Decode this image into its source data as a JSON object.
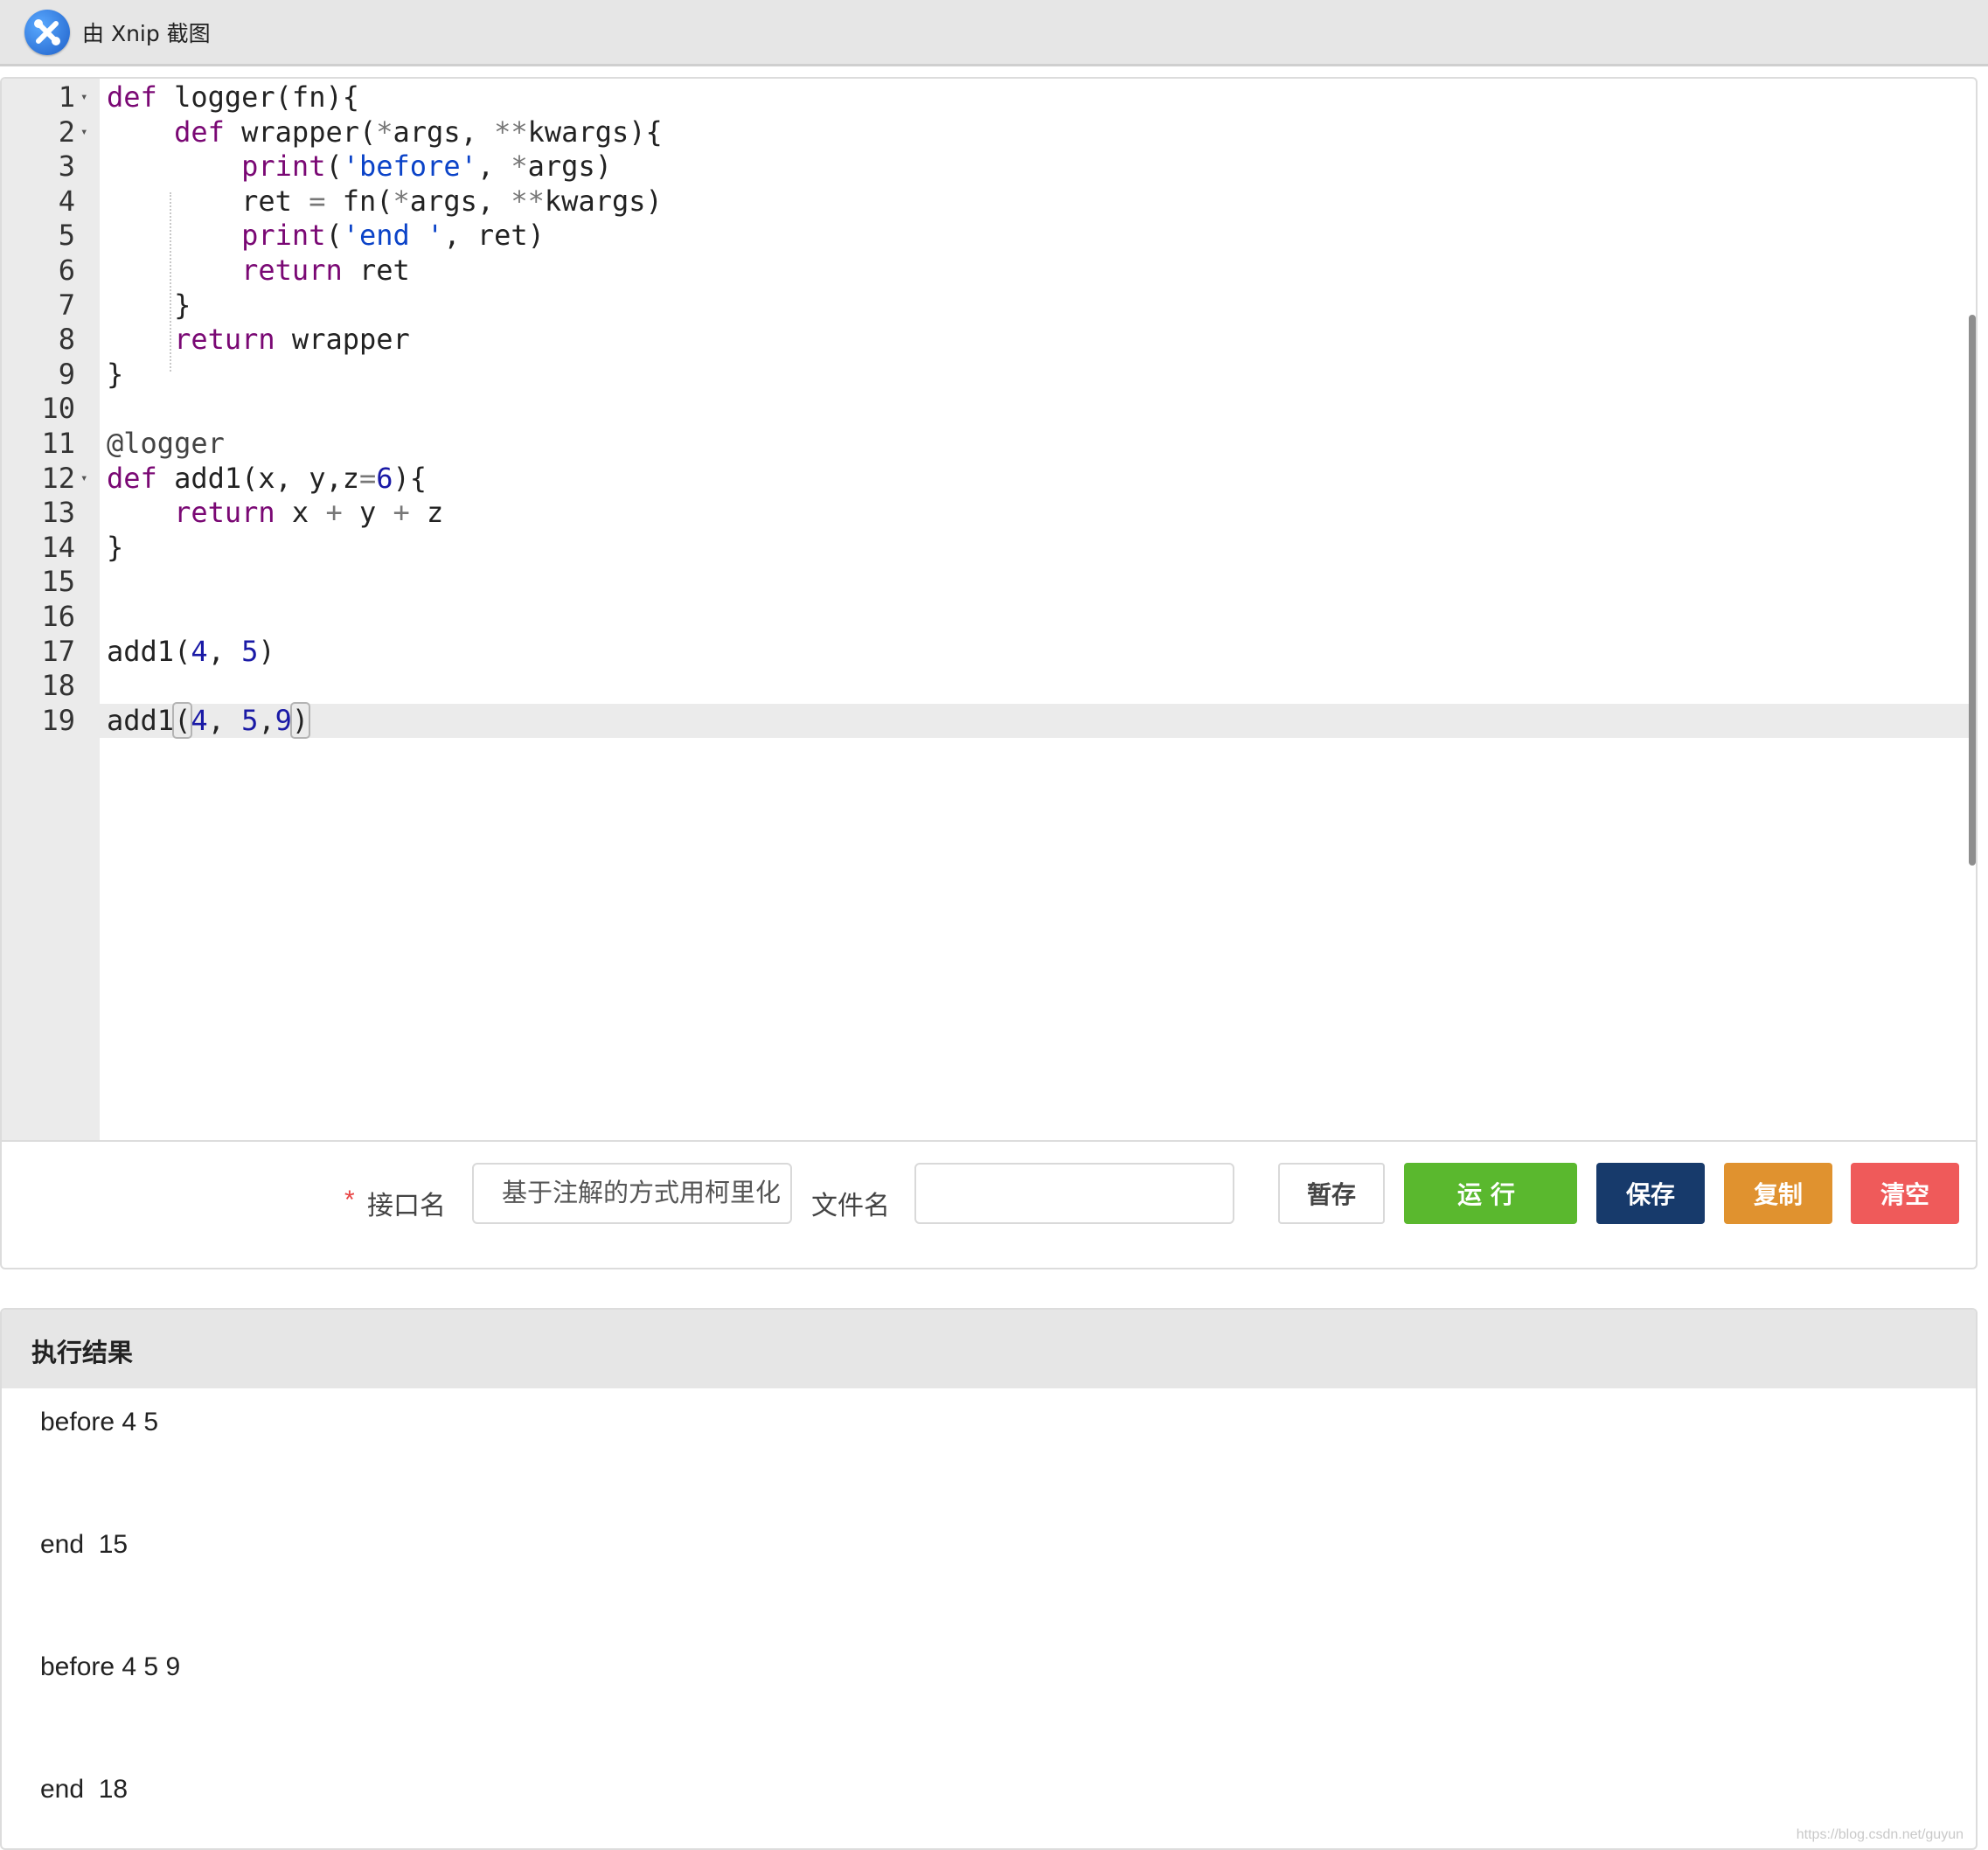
{
  "header": {
    "app_label": "由 Xnip 截图"
  },
  "editor": {
    "lines": [
      {
        "num": "1",
        "fold": true,
        "tokens": [
          {
            "t": "def",
            "c": "kw"
          },
          {
            "t": " logger(fn){"
          }
        ]
      },
      {
        "num": "2",
        "fold": true,
        "tokens": [
          {
            "t": "    "
          },
          {
            "t": "def",
            "c": "kw"
          },
          {
            "t": " wrapper("
          },
          {
            "t": "*",
            "c": "op"
          },
          {
            "t": "args, "
          },
          {
            "t": "**",
            "c": "op"
          },
          {
            "t": "kwargs){"
          }
        ]
      },
      {
        "num": "3",
        "tokens": [
          {
            "t": "        "
          },
          {
            "t": "print",
            "c": "kw"
          },
          {
            "t": "("
          },
          {
            "t": "'before'",
            "c": "str"
          },
          {
            "t": ", "
          },
          {
            "t": "*",
            "c": "op"
          },
          {
            "t": "args)"
          }
        ]
      },
      {
        "num": "4",
        "tokens": [
          {
            "t": "        ret "
          },
          {
            "t": "=",
            "c": "op"
          },
          {
            "t": " fn("
          },
          {
            "t": "*",
            "c": "op"
          },
          {
            "t": "args, "
          },
          {
            "t": "**",
            "c": "op"
          },
          {
            "t": "kwargs)"
          }
        ]
      },
      {
        "num": "5",
        "tokens": [
          {
            "t": "        "
          },
          {
            "t": "print",
            "c": "kw"
          },
          {
            "t": "("
          },
          {
            "t": "'end '",
            "c": "str"
          },
          {
            "t": ", ret)"
          }
        ]
      },
      {
        "num": "6",
        "tokens": [
          {
            "t": "        "
          },
          {
            "t": "return",
            "c": "kw"
          },
          {
            "t": " ret"
          }
        ]
      },
      {
        "num": "7",
        "tokens": [
          {
            "t": "    }"
          }
        ]
      },
      {
        "num": "8",
        "tokens": [
          {
            "t": "    "
          },
          {
            "t": "return",
            "c": "kw"
          },
          {
            "t": " wrapper"
          }
        ]
      },
      {
        "num": "9",
        "tokens": [
          {
            "t": "}"
          }
        ]
      },
      {
        "num": "10",
        "tokens": []
      },
      {
        "num": "11",
        "tokens": [
          {
            "t": "@logger",
            "c": "dec"
          }
        ]
      },
      {
        "num": "12",
        "fold": true,
        "tokens": [
          {
            "t": "def",
            "c": "kw"
          },
          {
            "t": " add1(x, y,z"
          },
          {
            "t": "=",
            "c": "op"
          },
          {
            "t": "6",
            "c": "num"
          },
          {
            "t": "){"
          }
        ]
      },
      {
        "num": "13",
        "tokens": [
          {
            "t": "    "
          },
          {
            "t": "return",
            "c": "kw"
          },
          {
            "t": " x "
          },
          {
            "t": "+",
            "c": "op"
          },
          {
            "t": " y "
          },
          {
            "t": "+",
            "c": "op"
          },
          {
            "t": " z"
          }
        ]
      },
      {
        "num": "14",
        "tokens": [
          {
            "t": "}"
          }
        ]
      },
      {
        "num": "15",
        "tokens": []
      },
      {
        "num": "16",
        "tokens": []
      },
      {
        "num": "17",
        "tokens": [
          {
            "t": "add1("
          },
          {
            "t": "4",
            "c": "num"
          },
          {
            "t": ", "
          },
          {
            "t": "5",
            "c": "num"
          },
          {
            "t": ")"
          }
        ]
      },
      {
        "num": "18",
        "tokens": []
      },
      {
        "num": "19",
        "active": true,
        "tokens": [
          {
            "t": "add1"
          },
          {
            "t": "(",
            "c": "bm"
          },
          {
            "t": "4",
            "c": "num"
          },
          {
            "t": ", "
          },
          {
            "t": "5",
            "c": "num"
          },
          {
            "t": ","
          },
          {
            "t": "9",
            "c": "num"
          },
          {
            "t": ")",
            "c": "bm"
          }
        ]
      }
    ]
  },
  "form": {
    "required_mark": "*",
    "api_name_label": "接口名",
    "api_name_value": "基于注解的方式用柯里化",
    "file_name_label": "文件名",
    "file_name_value": "",
    "buttons": {
      "temp_save": "暂存",
      "run": "运行",
      "save": "保存",
      "copy": "复制",
      "clear": "清空"
    }
  },
  "result": {
    "title": "执行结果",
    "lines": [
      "before 4 5",
      "end  15",
      "before 4 5 9",
      "end  18"
    ]
  },
  "watermark": "https://blog.csdn.net/guyun"
}
